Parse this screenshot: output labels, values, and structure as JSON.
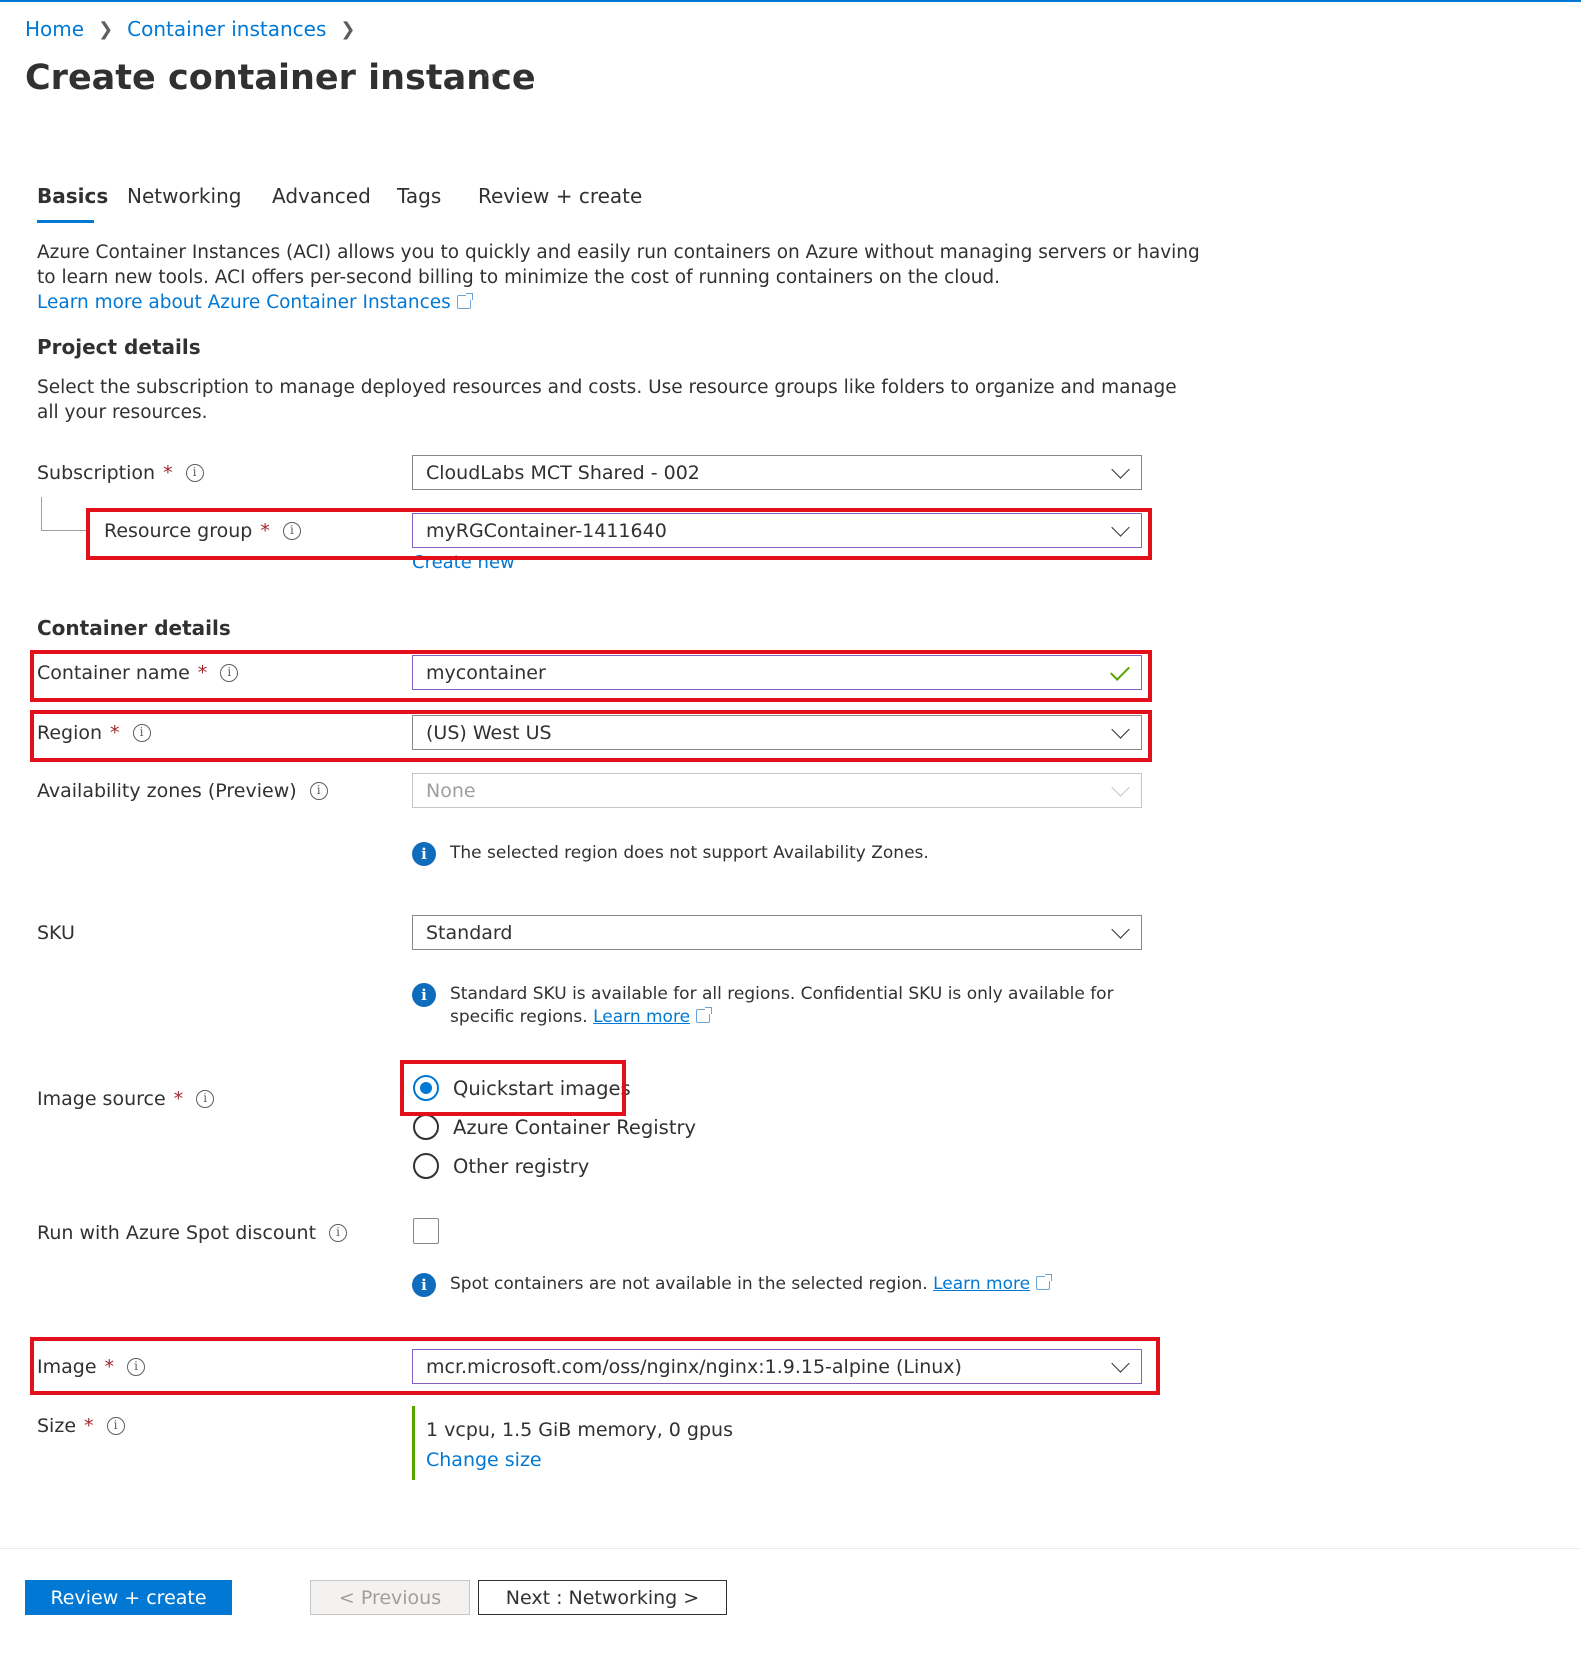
{
  "breadcrumb": {
    "home": "Home",
    "container_instances": "Container instances"
  },
  "page": {
    "title": "Create container instance",
    "more_icon": "more-icon"
  },
  "tabs": [
    {
      "label": "Basics",
      "active": true
    },
    {
      "label": "Networking"
    },
    {
      "label": "Advanced"
    },
    {
      "label": "Tags"
    },
    {
      "label": "Review + create"
    }
  ],
  "intro": {
    "line1": "Azure Container Instances (ACI) allows you to quickly and easily run containers on Azure without managing servers or having",
    "line2": "to learn new tools. ACI offers per-second billing to minimize the cost of running containers on the cloud.",
    "learn_more": "Learn more about Azure Container Instances"
  },
  "project": {
    "heading": "Project details",
    "desc_line1": "Select the subscription to manage deployed resources and costs. Use resource groups like folders to organize and manage",
    "desc_line2": "all your resources.",
    "subscription": {
      "label": "Subscription",
      "value": "CloudLabs MCT Shared - 002"
    },
    "resource_group": {
      "label": "Resource group",
      "value": "myRGContainer-1411640",
      "create_new": "Create new"
    }
  },
  "container": {
    "heading": "Container details",
    "name": {
      "label": "Container name",
      "value": "mycontainer"
    },
    "region": {
      "label": "Region",
      "value": "(US) West US"
    },
    "zones": {
      "label": "Availability zones (Preview)",
      "value": "None",
      "note": "The selected region does not support Availability Zones."
    },
    "sku": {
      "label": "SKU",
      "value": "Standard",
      "note_line1": "Standard SKU is available for all regions. Confidential SKU is only available for",
      "note_line2": "specific regions.",
      "learn_more": "Learn more"
    },
    "image_source": {
      "label": "Image source",
      "options": [
        "Quickstart images",
        "Azure Container Registry",
        "Other registry"
      ],
      "selected": "Quickstart images"
    },
    "spot": {
      "label": "Run with Azure Spot discount",
      "checked": false,
      "note": "Spot containers are not available in the selected region.",
      "learn_more": "Learn more"
    },
    "image": {
      "label": "Image",
      "value": "mcr.microsoft.com/oss/nginx/nginx:1.9.15-alpine (Linux)"
    },
    "size": {
      "label": "Size",
      "value": "1 vcpu, 1.5 GiB memory, 0 gpus",
      "change": "Change size"
    }
  },
  "footer": {
    "review_create": "Review + create",
    "previous": "< Previous",
    "next": "Next : Networking >"
  },
  "colors": {
    "accent": "#0078d4",
    "highlight": "#e3101c",
    "required": "#a4262c",
    "valid": "#57a300"
  }
}
